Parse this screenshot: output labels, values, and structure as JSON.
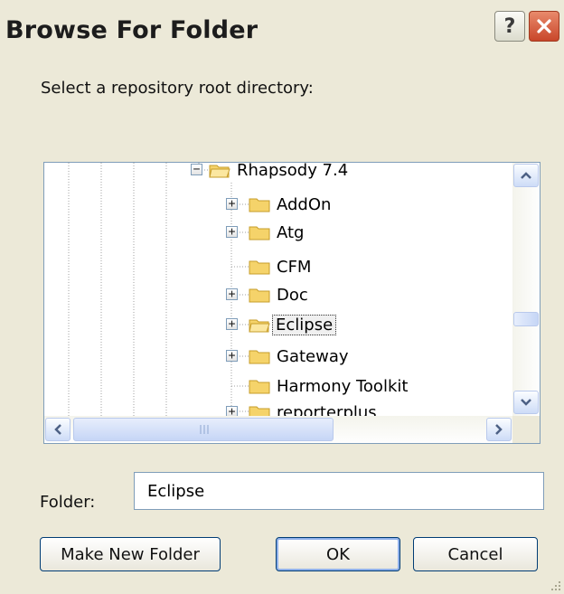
{
  "window": {
    "title": "Browse For Folder",
    "help_label": "?",
    "close_icon": "close-icon"
  },
  "prompt": "Select a repository root directory:",
  "tree": {
    "root": {
      "label": "Rhapsody 7.4",
      "expanded": true
    },
    "children": [
      {
        "label": "AddOn",
        "expander": "+"
      },
      {
        "label": "Atg",
        "expander": "+"
      },
      {
        "label": "CFM",
        "expander": ""
      },
      {
        "label": "Doc",
        "expander": "+"
      },
      {
        "label": "Eclipse",
        "expander": "+",
        "selected": true
      },
      {
        "label": "Gateway",
        "expander": "+"
      },
      {
        "label": "Harmony Toolkit",
        "expander": ""
      },
      {
        "label": "reporterplus",
        "expander": "+"
      }
    ]
  },
  "folder_field": {
    "label": "Folder:",
    "value": "Eclipse"
  },
  "buttons": {
    "make_new_folder": "Make New Folder",
    "ok": "OK",
    "cancel": "Cancel"
  },
  "colors": {
    "dialog_bg": "#ece9d8",
    "border": "#7f9db9",
    "close_red": "#c9462a",
    "folder_yellow": "#f5d36a"
  }
}
